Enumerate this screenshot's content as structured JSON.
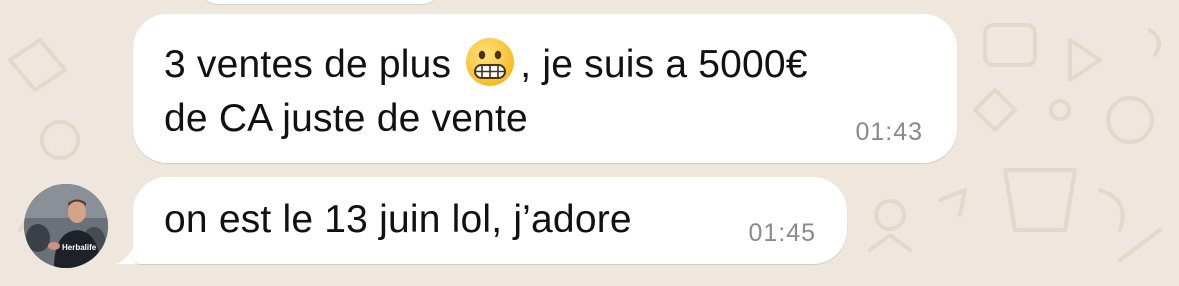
{
  "conversation": {
    "messages": [
      {
        "line_1_before_emoji": "3 ventes de plus ",
        "emoji": "grimacing-face",
        "line_1_after_emoji": ", je suis a 5000€",
        "line_2": "de CA juste de vente",
        "time": "01:43"
      },
      {
        "line_1": "on est le 13 juin lol, j’adore",
        "time": "01:45"
      }
    ],
    "sender_avatar": {
      "shirt_text": "Herbalife"
    }
  },
  "colors": {
    "wallpaper": "#efe7dd",
    "bubble": "#ffffff",
    "text": "#111111",
    "timestamp": "#8a8a8a"
  },
  "icons": [
    "grimacing-face-emoji",
    "wallpaper-doodle-pattern"
  ]
}
